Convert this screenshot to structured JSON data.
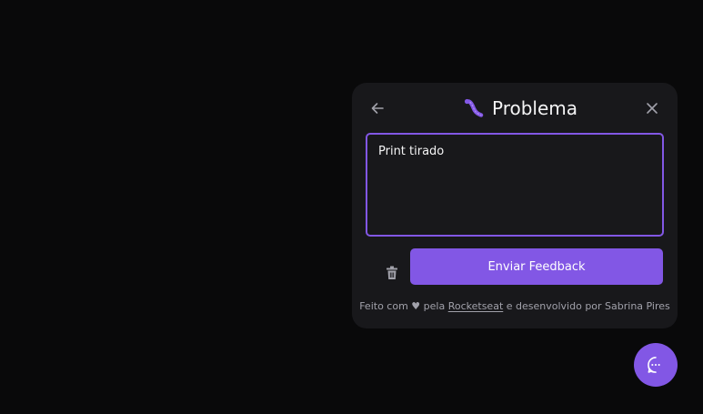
{
  "widget": {
    "title": "Problema",
    "title_icon": "worm-icon",
    "back_icon": "arrow-left-icon",
    "close_icon": "close-icon"
  },
  "form": {
    "textarea_value": "Print tirado",
    "trash_icon": "trash-icon",
    "submit_label": "Enviar Feedback"
  },
  "footer": {
    "prefix": "Feito com",
    "heart": "♥",
    "pela": "pela",
    "link_text": "Rocketseat",
    "suffix": "e desenvolvido por Sabrina Pires"
  },
  "fab": {
    "icon": "chat-bubble-icon"
  },
  "colors": {
    "background": "#09090a",
    "panel": "#18181b",
    "accent": "#8257e5",
    "text": "#f4f4f5",
    "muted": "#a1a1aa"
  }
}
